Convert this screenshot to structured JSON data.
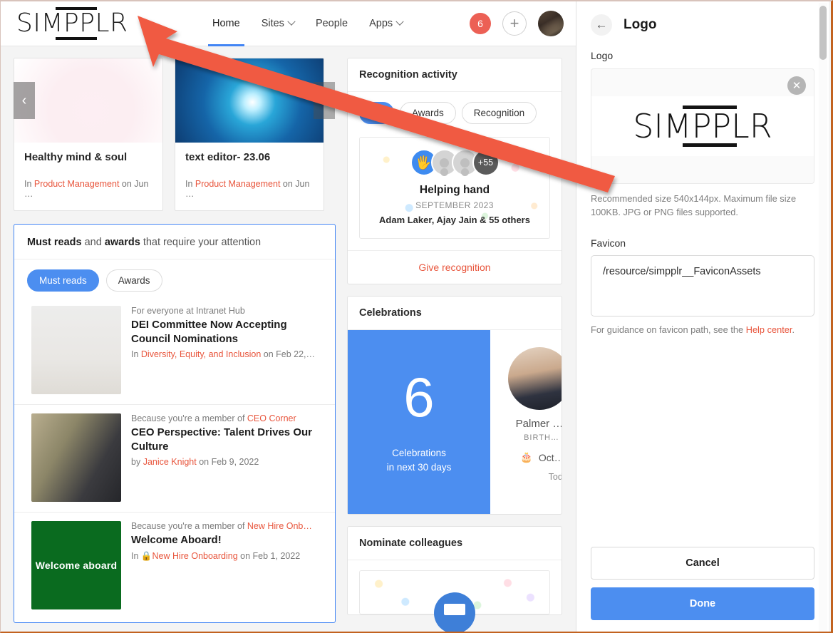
{
  "app": {
    "logo_text": "SIMPPLR",
    "nav": [
      {
        "label": "Home",
        "icon": "",
        "active": true
      },
      {
        "label": "Sites",
        "icon": "chevron-down-icon",
        "active": false
      },
      {
        "label": "People",
        "icon": "",
        "active": false
      },
      {
        "label": "Apps",
        "icon": "chevron-down-icon",
        "active": false
      }
    ],
    "notification_count": "6",
    "create_label": "+"
  },
  "carousel": {
    "prev_label": "‹",
    "next_label": "›",
    "cards": [
      {
        "title": "Healthy mind & soul",
        "meta_pre": "In ",
        "meta_link": "Product Management",
        "meta_post": " on Jun …"
      },
      {
        "title": "text editor- 23.06",
        "meta_pre": "In ",
        "meta_link": "Product Management",
        "meta_post": " on Jun …"
      }
    ]
  },
  "must_reads": {
    "heading_bold_1": "Must reads",
    "heading_mid": " and ",
    "heading_bold_2": "awards",
    "heading_tail": " that require your attention",
    "tabs": [
      {
        "label": "Must reads",
        "selected": true
      },
      {
        "label": "Awards",
        "selected": false
      }
    ],
    "articles": [
      {
        "kicker": "For everyone at Intranet Hub",
        "title": "DEI Committee Now Accepting Council Nominations",
        "sub_pre": "In ",
        "sub_link": "Diversity, Equity, and Inclusion",
        "sub_post": " on Feb 22,…",
        "thumb": "raised-hands-photo",
        "lock": false
      },
      {
        "kicker_pre": "Because you're a member of ",
        "kicker_link": "CEO Corner",
        "title": "CEO Perspective: Talent Drives Our Culture",
        "sub_pre": "by ",
        "sub_link": "Janice Knight",
        "sub_post": " on Feb 9, 2022",
        "thumb": "two-colleagues-photo",
        "lock": false
      },
      {
        "kicker_pre": "Because you're a member of ",
        "kicker_link": "New Hire Onb…",
        "title": "Welcome Aboard!",
        "sub_pre": "In ",
        "sub_link": "New Hire Onboarding",
        "sub_post": " on Feb 1, 2022",
        "thumb": "welcome-aboard-photo",
        "thumb_text": "Welcome aboard",
        "lock": true,
        "lock_icon": "lock-icon"
      }
    ]
  },
  "recognition": {
    "title": "Recognition activity",
    "filters": [
      {
        "label": "All",
        "selected": true
      },
      {
        "label": "Awards",
        "selected": false
      },
      {
        "label": "Recognition",
        "selected": false
      }
    ],
    "item": {
      "badge_icon": "helping-hands-icon",
      "extra_count": "+55",
      "title": "Helping hand",
      "date": "SEPTEMBER 2023",
      "people": "Adam Laker, Ajay Jain & 55 others"
    },
    "footer_action": "Give recognition"
  },
  "celebrations": {
    "title": "Celebrations",
    "count": "6",
    "caption_line1": "Celebrations",
    "caption_line2": "in next 30 days",
    "person": {
      "name": "Palmer …",
      "kind": "BIRTH…",
      "date_icon": "birthday-cake-icon",
      "date": "Oct…",
      "today": "Tod…"
    }
  },
  "nominate": {
    "title": "Nominate colleagues"
  },
  "panel": {
    "back_icon": "arrow-left-icon",
    "title": "Logo",
    "logo_field_label": "Logo",
    "logo_preview_text": "SIMPPLR",
    "remove_icon": "close-icon",
    "logo_hint": "Recommended size 540x144px. Maximum file size 100KB. JPG or PNG files supported.",
    "favicon_label": "Favicon",
    "favicon_value": "/resource/simpplr__FaviconAssets",
    "favicon_hint_pre": "For guidance on favicon path, see the ",
    "favicon_hint_link": "Help center",
    "favicon_hint_post": ".",
    "cancel_label": "Cancel",
    "done_label": "Done"
  },
  "colors": {
    "accent_blue": "#4c8ef0",
    "link_orange": "#e8553c",
    "annotation_arrow": "#f05a42",
    "badge_red": "#ec6055"
  }
}
